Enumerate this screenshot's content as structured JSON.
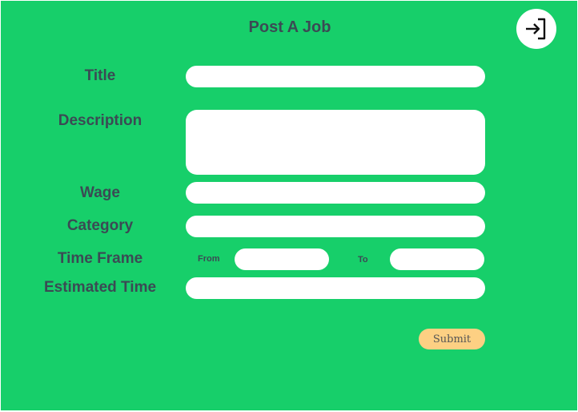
{
  "page": {
    "title": "Post A Job"
  },
  "header": {
    "logout_icon": "login-arrow-icon"
  },
  "form": {
    "title": {
      "label": "Title",
      "value": ""
    },
    "description": {
      "label": "Description",
      "value": ""
    },
    "wage": {
      "label": "Wage",
      "value": ""
    },
    "category": {
      "label": "Category",
      "value": ""
    },
    "time_frame": {
      "label": "Time Frame",
      "from_label": "From",
      "to_label": "To",
      "from_value": "",
      "to_value": ""
    },
    "estimated_time": {
      "label": "Estimated Time",
      "value": ""
    },
    "submit_label": "Submit"
  },
  "colors": {
    "background": "#17cf6a",
    "text": "#3b4a54",
    "submit": "#fdd083"
  }
}
